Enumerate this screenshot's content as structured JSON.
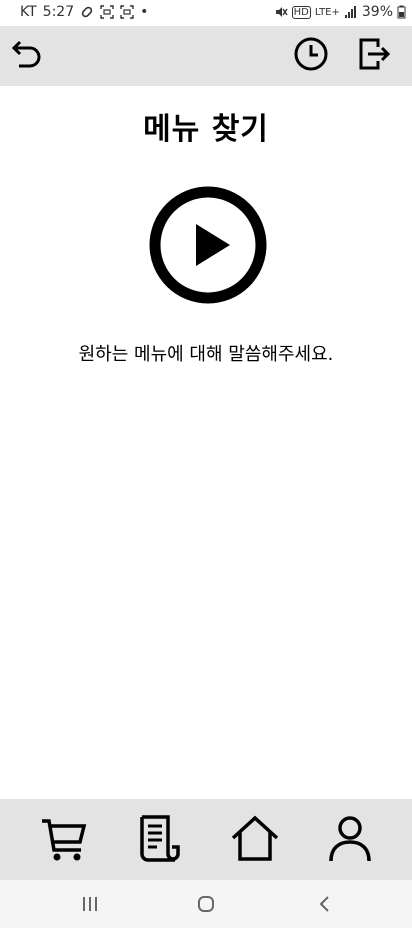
{
  "status_bar": {
    "carrier": "KT",
    "time": "5:27",
    "dot": "•",
    "network": "LTE+",
    "hd": "HD",
    "battery": "39%"
  },
  "header": {
    "back_icon": "undo-arrow-icon",
    "history_icon": "clock-icon",
    "logout_icon": "logout-icon"
  },
  "main": {
    "title": "메뉴 찾기",
    "play_icon": "play-circle-icon",
    "prompt": "원하는 메뉴에 대해 말씀해주세요."
  },
  "bottom_nav": {
    "items": [
      {
        "icon": "cart-icon"
      },
      {
        "icon": "receipt-icon"
      },
      {
        "icon": "home-icon"
      },
      {
        "icon": "user-icon"
      }
    ]
  },
  "system_nav": {
    "recent_icon": "recent-apps-icon",
    "home_icon": "home-circle-icon",
    "back_icon": "back-chevron-icon"
  },
  "colors": {
    "bar_background": "#e3e3e3",
    "background": "#ffffff",
    "icon": "#000000"
  }
}
